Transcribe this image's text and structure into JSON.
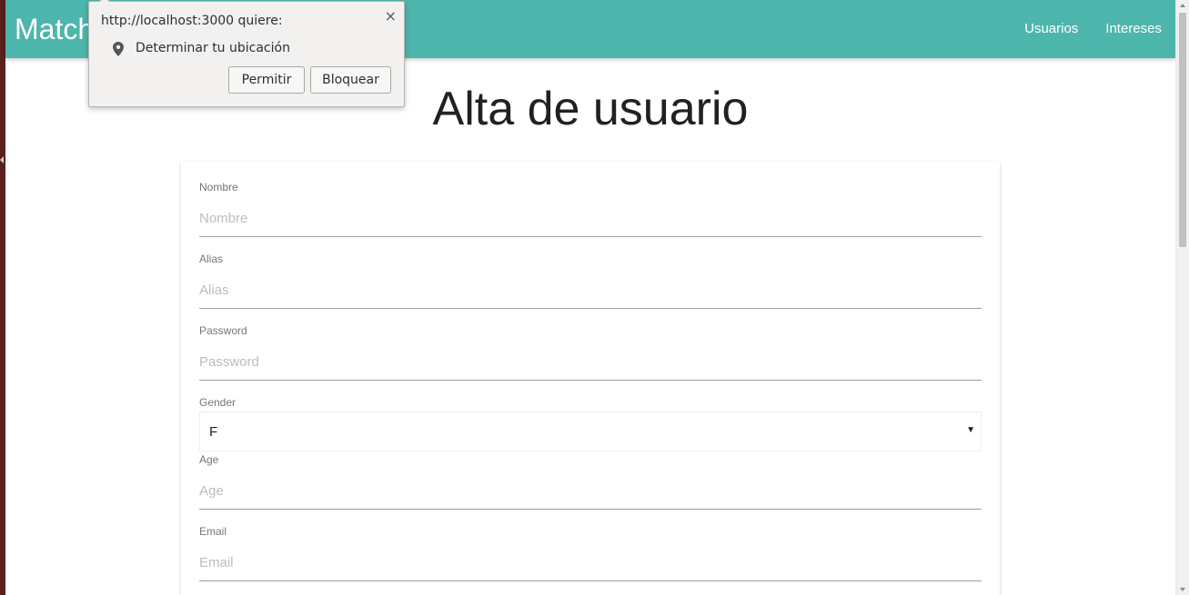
{
  "navbar": {
    "brand": "Match",
    "links": [
      "Usuarios",
      "Intereses"
    ],
    "color": "#4db6ac"
  },
  "page": {
    "title": "Alta de usuario"
  },
  "form": {
    "nombre": {
      "label": "Nombre",
      "placeholder": "Nombre",
      "value": ""
    },
    "alias": {
      "label": "Alias",
      "placeholder": "Alias",
      "value": ""
    },
    "password": {
      "label": "Password",
      "placeholder": "Password",
      "value": ""
    },
    "gender": {
      "label": "Gender",
      "selected": "F",
      "caret": "▼"
    },
    "age": {
      "label": "Age",
      "placeholder": "Age",
      "value": ""
    },
    "email": {
      "label": "Email",
      "placeholder": "Email",
      "value": ""
    }
  },
  "permission_popup": {
    "title": "http://localhost:3000 quiere:",
    "close": "×",
    "permission_icon": "location-pin-icon",
    "permission": "Determinar tu ubicación",
    "allow_label": "Permitir",
    "block_label": "Bloquear"
  }
}
